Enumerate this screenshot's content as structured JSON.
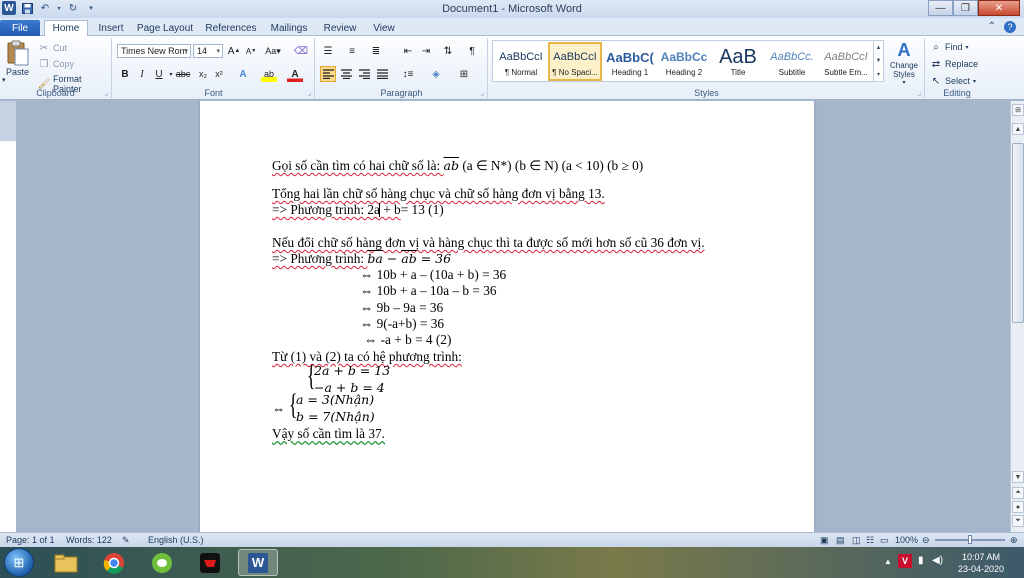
{
  "app": {
    "title": "Document1 - Microsoft Word",
    "logo_letter": "W"
  },
  "tabs": [
    "File",
    "Home",
    "Insert",
    "Page Layout",
    "References",
    "Mailings",
    "Review",
    "View"
  ],
  "ribbon": {
    "clipboard": {
      "paste": "Paste",
      "cut": "Cut",
      "copy": "Copy",
      "format_painter": "Format Painter",
      "label": "Clipboard"
    },
    "font": {
      "name": "Times New Rom",
      "size": "14",
      "label": "Font"
    },
    "paragraph": {
      "label": "Paragraph"
    },
    "styles": {
      "label": "Styles",
      "items": [
        {
          "sample": "AaBbCcI",
          "name": "¶ Normal"
        },
        {
          "sample": "AaBbCcI",
          "name": "¶ No Spaci..."
        },
        {
          "sample": "AaBbC(",
          "name": "Heading 1"
        },
        {
          "sample": "AaBbCc",
          "name": "Heading 2"
        },
        {
          "sample": "AaB",
          "name": "Title"
        },
        {
          "sample": "AaBbCc.",
          "name": "Subtitle"
        },
        {
          "sample": "AaBbCcI",
          "name": "Subtle Em..."
        }
      ],
      "change_styles": "Change Styles"
    },
    "editing": {
      "find": "Find",
      "replace": "Replace",
      "select": "Select",
      "label": "Editing"
    }
  },
  "document": {
    "line1_prefix": "Gọi số cần tìm có hai chữ số là: ",
    "line1_ab": "ab",
    "line1_suffix": " (a ∈ N*) (b ∈ N) (a < 10) (b ≥ 0)",
    "line2": "Tổng hai lần chữ số hàng chục và chữ số hàng đơn vị bằng 13.",
    "line3_pre": "=> Phương trình: 2a + b",
    "line3_post": "= 13 (1)",
    "line4": "Nếu đổi chữ số hàng đơn vị và hàng chục thì ta được số mới hơn số cũ 36 đơn vị.",
    "line5_pre": "=> Phương trình: ",
    "line5_ba": "ba",
    "line5_minus": " − ",
    "line5_ab": "ab",
    "line5_eq": " = 36",
    "step1": "⇔ 10b + a – (10a + b) = 36",
    "step2": "⇔ 10b + a – 10a – b = 36",
    "step3": "⇔ 9b – 9a = 36",
    "step4": "⇔ 9(-a+b) = 36",
    "step5": "⇔ -a + b = 4 (2)",
    "line_system": "Từ (1) và (2) ta có hệ phương trình:",
    "sys_eq1": "2a + b = 13",
    "sys_eq2": "−a + b = 4",
    "sol_arrow": "⇔",
    "sol_eq1": "a = 3(Nhận)",
    "sol_eq2": "b = 7(Nhận)",
    "conclusion": "Vậy số cần tìm là 37."
  },
  "status": {
    "page": "Page: 1 of 1",
    "words": "Words: 122",
    "language": "English (U.S.)",
    "zoom": "100%",
    "zoom_level": 0.5
  },
  "taskbar": {
    "time": "10:07 AM",
    "date": "23-04-2020"
  }
}
